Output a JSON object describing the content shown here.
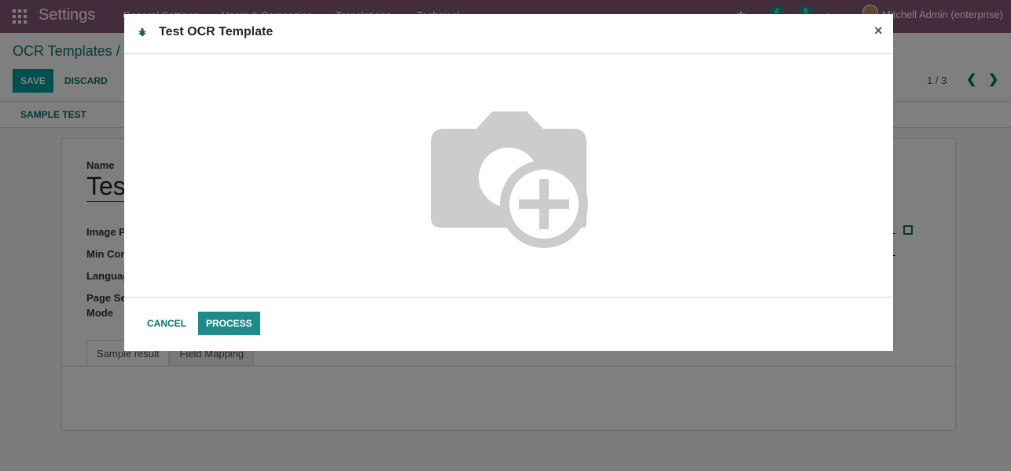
{
  "navbar": {
    "brand": "Settings",
    "menu": [
      "General Settings",
      "Users & Companies",
      "Translations",
      "Technical"
    ],
    "chat_badge": "4",
    "activity_badge": "8",
    "user": "Mitchell Admin (enterprise)"
  },
  "control_panel": {
    "breadcrumb": "OCR Templates / T",
    "save_label": "SAVE",
    "discard_label": "DISCARD",
    "pager": "1 / 3"
  },
  "statusbar": {
    "sample_test_label": "SAMPLE TEST"
  },
  "form": {
    "name_label": "Name",
    "name_value": "Tes",
    "fields": [
      "Image P",
      "Min Con",
      "Languag",
      "Page Se",
      "Mode"
    ],
    "tabs": [
      "Sample result",
      "Field Mapping"
    ]
  },
  "modal": {
    "title": "Test OCR Template",
    "close": "×",
    "cancel_label": "CANCEL",
    "process_label": "PROCESS"
  },
  "colors": {
    "navbar": "#875a7b",
    "primary": "#00a09d",
    "link": "#00796b",
    "placeholder_icon": "#cccccc"
  }
}
